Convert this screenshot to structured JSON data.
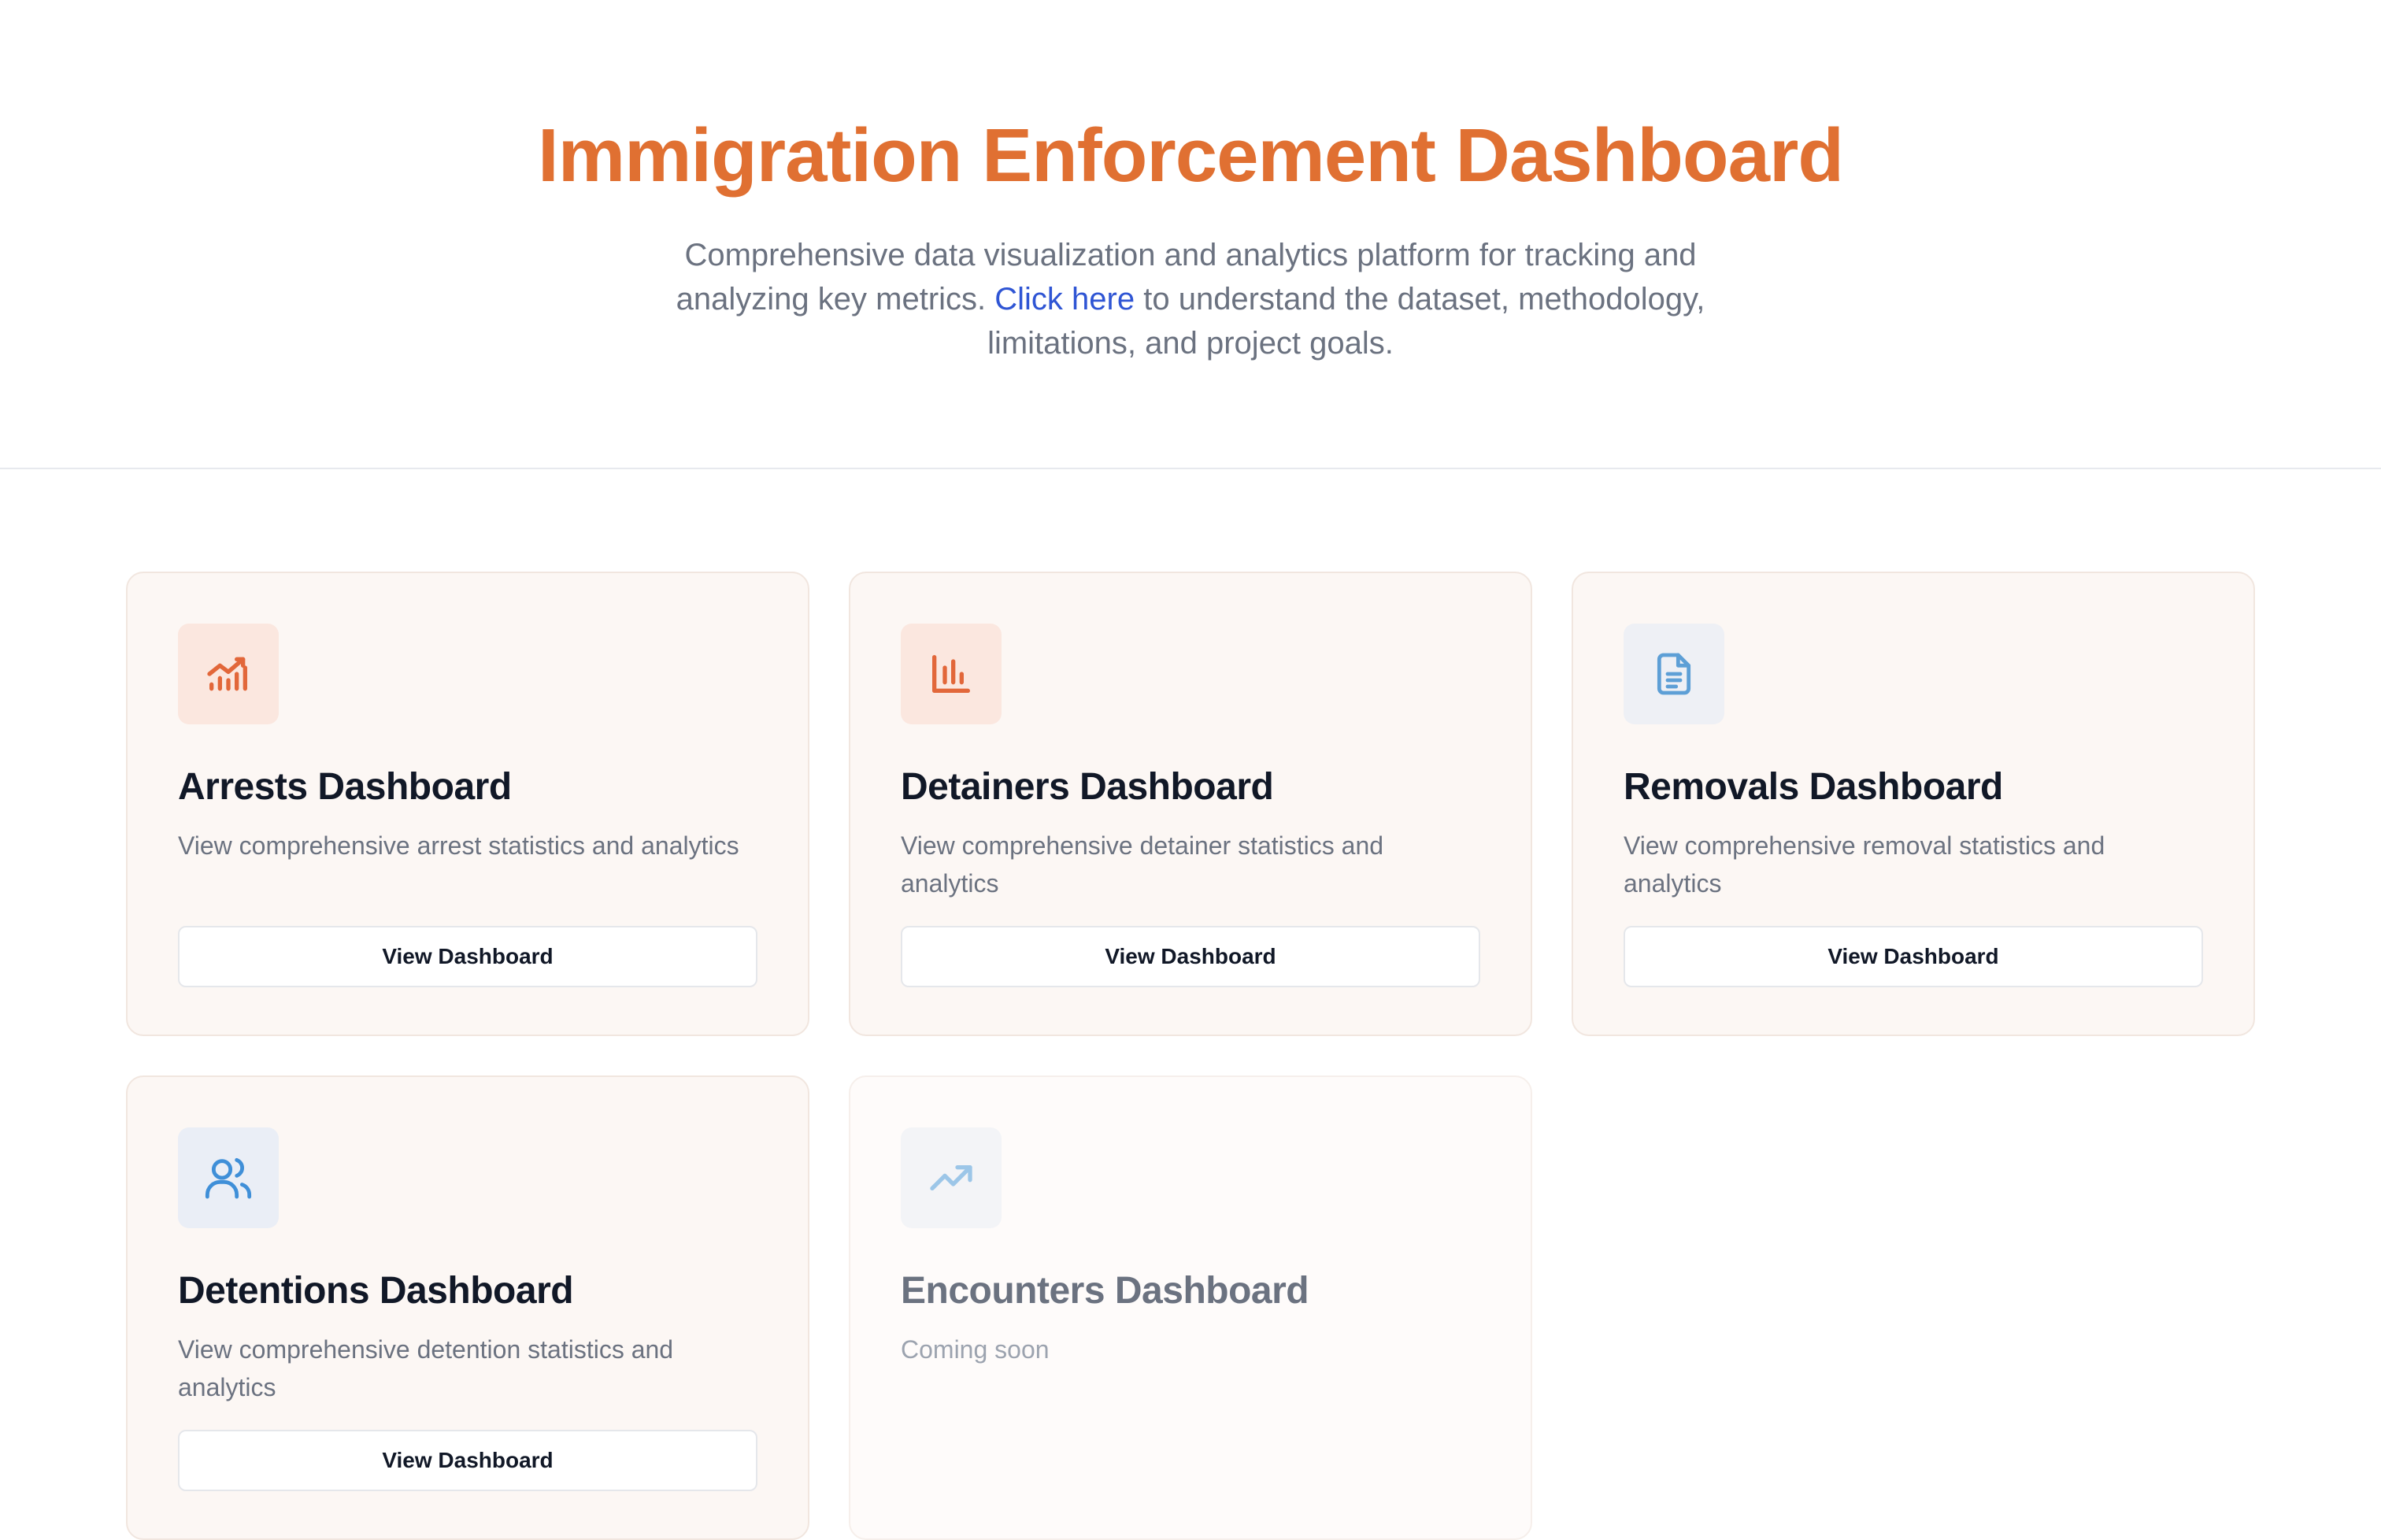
{
  "header": {
    "title": "Immigration Enforcement Dashboard",
    "subtitle_before": "Comprehensive data visualization and analytics platform for tracking and analyzing key metrics. ",
    "link_text": "Click here",
    "subtitle_after": " to understand the dataset, methodology, limitations, and project goals."
  },
  "colors": {
    "title": "#e07032",
    "link": "#2f55d4",
    "card_bg": "#fcf7f4"
  },
  "cards": [
    {
      "title": "Arrests Dashboard",
      "description": "View comprehensive arrest statistics and analytics",
      "button_label": "View Dashboard",
      "icon": "chart-line-bars-icon"
    },
    {
      "title": "Detainers Dashboard",
      "description": "View comprehensive detainer statistics and analytics",
      "button_label": "View Dashboard",
      "icon": "bar-chart-icon"
    },
    {
      "title": "Removals Dashboard",
      "description": "View comprehensive removal statistics and analytics",
      "button_label": "View Dashboard",
      "icon": "document-icon"
    },
    {
      "title": "Detentions Dashboard",
      "description": "View comprehensive detention statistics and analytics",
      "button_label": "View Dashboard",
      "icon": "users-icon"
    },
    {
      "title": "Encounters Dashboard",
      "description": "Coming soon",
      "icon": "trending-up-icon"
    }
  ]
}
